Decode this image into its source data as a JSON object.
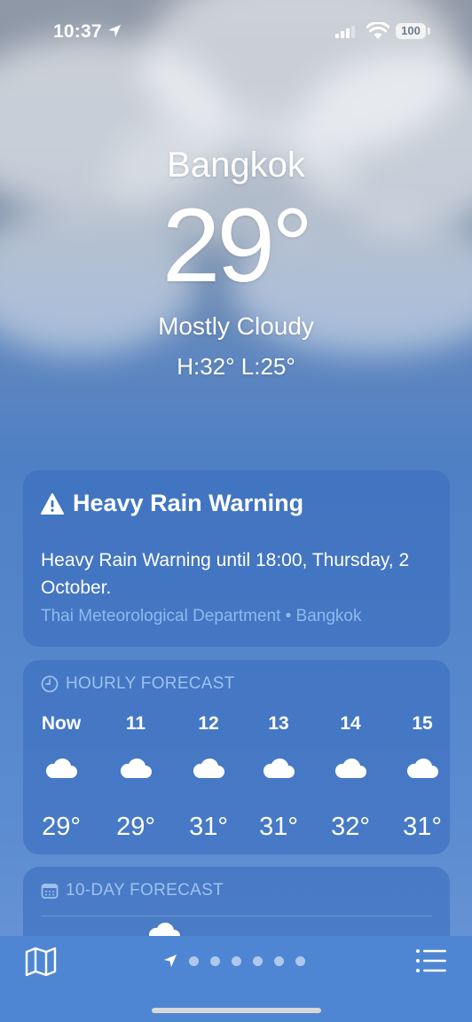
{
  "status_bar": {
    "time": "10:37",
    "battery": "100"
  },
  "current": {
    "city": "Bangkok",
    "temperature": "29°",
    "condition": "Mostly Cloudy",
    "high_low": "H:32°  L:25°"
  },
  "warning": {
    "title": "Heavy Rain Warning",
    "body": "Heavy Rain Warning until 18:00, Thursday, 2 October.",
    "source": "Thai Meteorological Department • Bangkok"
  },
  "hourly": {
    "heading": "HOURLY FORECAST",
    "items": [
      {
        "label": "Now",
        "icon": "cloud-icon",
        "temp": "29°"
      },
      {
        "label": "11",
        "icon": "cloud-icon",
        "temp": "29°"
      },
      {
        "label": "12",
        "icon": "cloud-icon",
        "temp": "31°"
      },
      {
        "label": "13",
        "icon": "cloud-icon",
        "temp": "31°"
      },
      {
        "label": "14",
        "icon": "cloud-icon",
        "temp": "32°"
      },
      {
        "label": "15",
        "icon": "cloud-icon",
        "temp": "31°"
      }
    ]
  },
  "ten_day": {
    "heading": "10-DAY FORECAST"
  },
  "toolbar": {
    "page_count": 6
  },
  "colors": {
    "card": "#3a6ebe",
    "accent_text": "#8fbaf0",
    "toolbar": "#4f86d3"
  }
}
